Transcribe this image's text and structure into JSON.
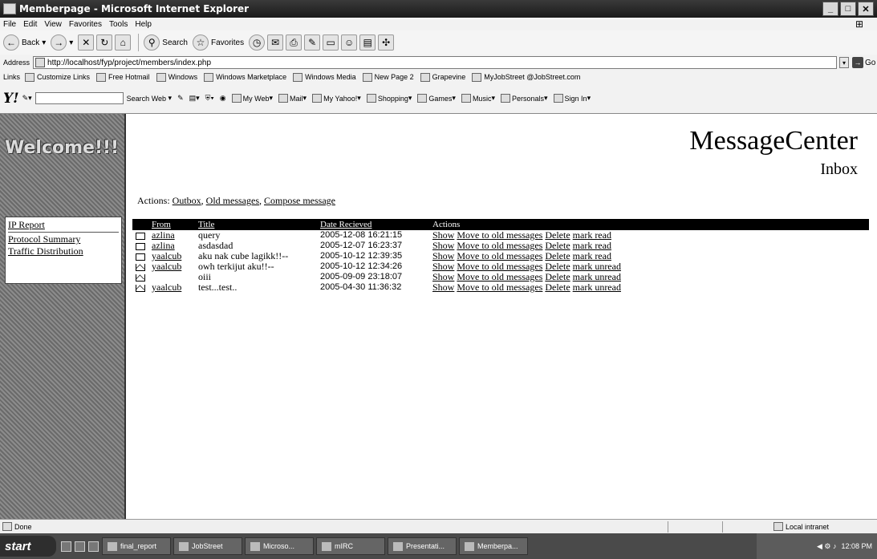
{
  "window": {
    "title": "Memberpage - Microsoft Internet Explorer"
  },
  "menu": [
    "File",
    "Edit",
    "View",
    "Favorites",
    "Tools",
    "Help"
  ],
  "toolbar": {
    "back": "Back",
    "search": "Search",
    "favorites": "Favorites"
  },
  "address": {
    "label": "Address",
    "url": "http://localhost/fyp/project/members/index.php",
    "go": "Go"
  },
  "links": {
    "label": "Links",
    "items": [
      "Customize Links",
      "Free Hotmail",
      "Windows",
      "Windows Marketplace",
      "Windows Media",
      "New Page 2",
      "Grapevine",
      "MyJobStreet @JobStreet.com"
    ]
  },
  "yahoo": {
    "logo": "Y!",
    "search_web": "Search Web",
    "items": [
      "My Web",
      "Mail",
      "My Yahoo!",
      "Shopping",
      "Games",
      "Music",
      "Personals",
      "Sign In"
    ]
  },
  "sidebar": {
    "welcome": "Welcome!!!",
    "submenu": [
      "IP Report",
      "Protocol Summary",
      "Traffic Distribution"
    ]
  },
  "page": {
    "title": "MessageCenter",
    "subtitle": "Inbox",
    "actions_label": "Actions:",
    "actions": [
      "Outbox",
      "Old messages",
      "Compose message"
    ],
    "columns": [
      "From",
      "Title",
      "Date Recieved",
      "Actions"
    ],
    "rows": [
      {
        "icon": "closed-envelope-icon",
        "from": "azlina",
        "title": "query",
        "date": "2005-12-08 16:21:15",
        "mark": "mark read"
      },
      {
        "icon": "closed-envelope-icon",
        "from": "azlina",
        "title": "asdasdad",
        "date": "2005-12-07 16:23:37",
        "mark": "mark read"
      },
      {
        "icon": "closed-envelope-icon",
        "from": "yaalcub",
        "title": "aku nak cube lagikk!!--",
        "date": "2005-10-12 12:39:35",
        "mark": "mark read"
      },
      {
        "icon": "open-envelope-icon",
        "from": "yaalcub",
        "title": "owh terkijut aku!!--",
        "date": "2005-10-12 12:34:26",
        "mark": "mark unread"
      },
      {
        "icon": "open-envelope-icon",
        "from": "",
        "title": "oiii",
        "date": "2005-09-09 23:18:07",
        "mark": "mark unread"
      },
      {
        "icon": "open-envelope-icon",
        "from": "yaalcub",
        "title": "test...test..",
        "date": "2005-04-30 11:36:32",
        "mark": "mark unread"
      }
    ],
    "row_actions": {
      "show": "Show",
      "move": "Move to old messages",
      "delete": "Delete"
    }
  },
  "status": {
    "text": "Done",
    "zone": "Local intranet"
  },
  "taskbar": {
    "start": "start",
    "tasks": [
      "final_report",
      "JobStreet",
      "Microso...",
      "mIRC",
      "Presentati...",
      "Memberpa..."
    ],
    "clock": "12:08 PM"
  }
}
